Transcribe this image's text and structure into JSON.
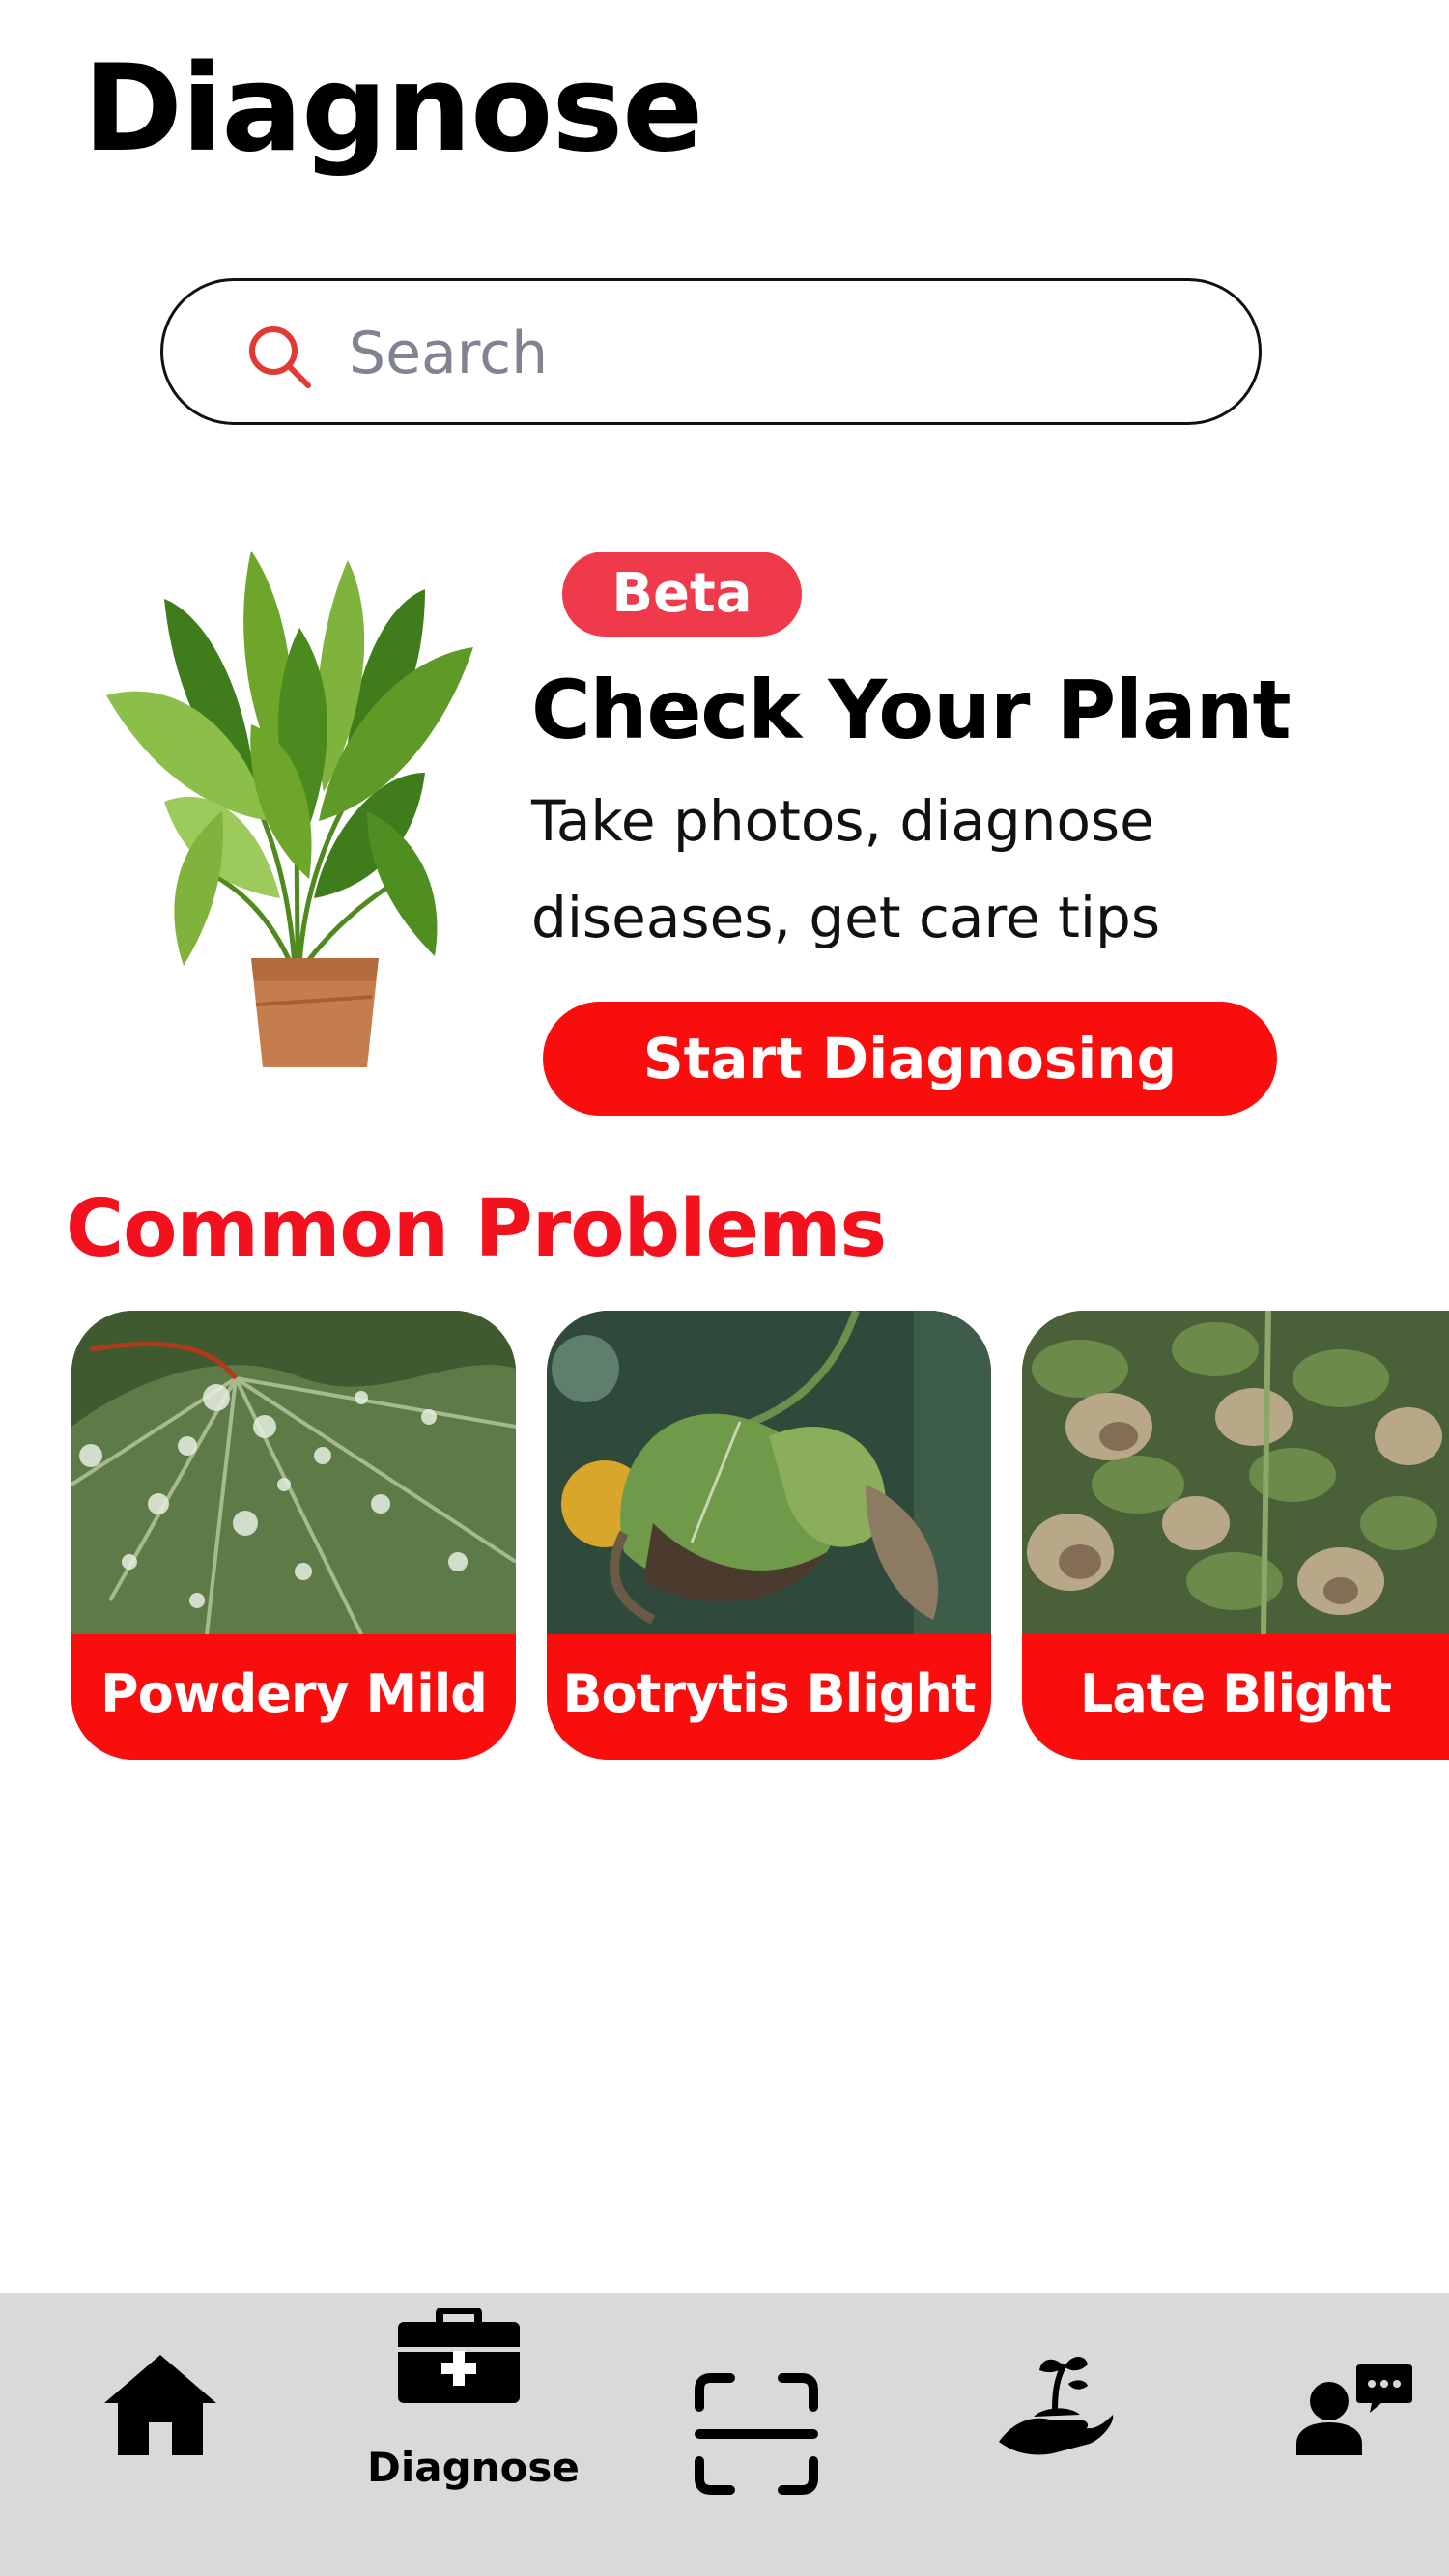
{
  "header": {
    "title": "Diagnose"
  },
  "search": {
    "placeholder": "Search"
  },
  "hero": {
    "badge": "Beta",
    "title": "Check Your Plant",
    "description": "Take photos, diagnose diseases, get care tips",
    "button_label": "Start Diagnosing"
  },
  "common_problems": {
    "title": "Common Problems",
    "items": [
      {
        "label": "Powdery Mild"
      },
      {
        "label": "Botrytis Blight"
      },
      {
        "label": "Late Blight"
      }
    ]
  },
  "bottom_nav": {
    "items": [
      {
        "icon": "home-icon",
        "label": ""
      },
      {
        "icon": "medical-kit-icon",
        "label": "Diagnose",
        "active": true
      },
      {
        "icon": "scan-icon",
        "label": ""
      },
      {
        "icon": "plant-in-hand-icon",
        "label": ""
      },
      {
        "icon": "chat-user-icon",
        "label": ""
      }
    ]
  },
  "colors": {
    "accent_red": "#fa0d0d",
    "badge_red": "#ef3a4c",
    "nav_background": "#d9d9d9"
  }
}
